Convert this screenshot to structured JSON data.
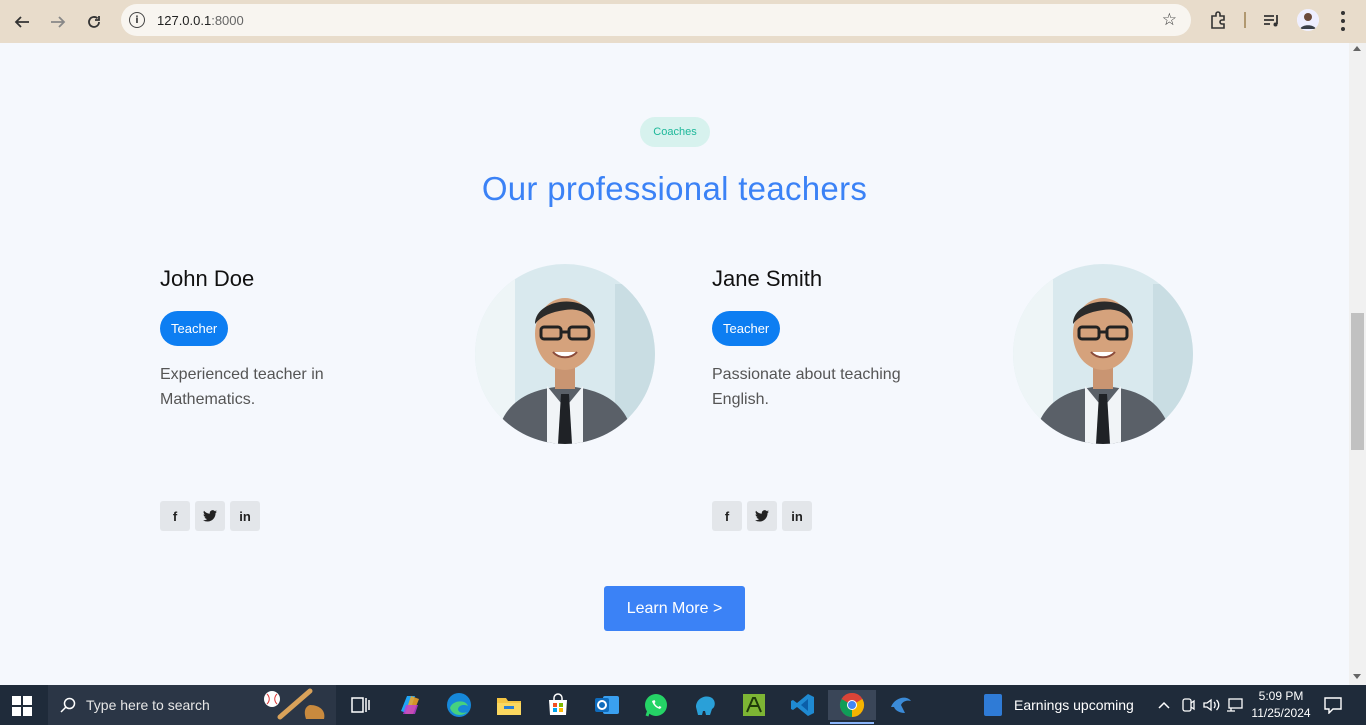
{
  "browser": {
    "url_host": "127.0.0.1",
    "url_port": ":8000"
  },
  "section": {
    "badge": "Coaches",
    "title": "Our professional teachers"
  },
  "teachers": [
    {
      "name": "John Doe",
      "role": "Teacher",
      "description": "Experienced teacher in Mathematics.",
      "socials": [
        "f",
        "twitter",
        "in"
      ]
    },
    {
      "name": "Jane Smith",
      "role": "Teacher",
      "description": "Passionate about teaching English.",
      "socials": [
        "f",
        "twitter",
        "in"
      ]
    }
  ],
  "cta": {
    "label": "Learn More >"
  },
  "taskbar": {
    "search_placeholder": "Type here to search",
    "news_text": "Earnings upcoming",
    "time": "5:09 PM",
    "date": "11/25/2024"
  },
  "colors": {
    "accent": "#3b82f6",
    "role_badge": "#0d7ef2",
    "coaches_badge_bg": "#d7f2ee",
    "coaches_badge_text": "#1eb89a"
  }
}
